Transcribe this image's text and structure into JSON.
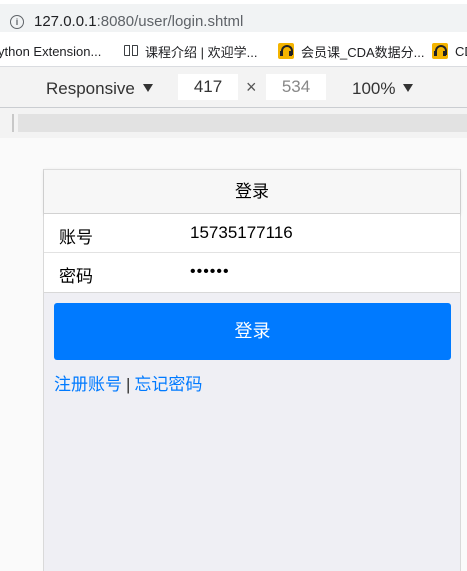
{
  "browser": {
    "url_host": "127.0.0.1",
    "url_rest": ":8080/user/login.shtml",
    "bookmarks": [
      {
        "label": "ython Extension..."
      },
      {
        "label": "课程介绍 | 欢迎学..."
      },
      {
        "label": "会员课_CDA数据分..."
      },
      {
        "label": "CD"
      }
    ]
  },
  "devtools": {
    "device": "Responsive",
    "width": "417",
    "times": "×",
    "height": "534",
    "zoom": "100%"
  },
  "page": {
    "title": "登录",
    "account_label": "账号",
    "account_value": "15735177116",
    "password_label": "密码",
    "password_value": "••••••",
    "login_button": "登录",
    "register_link": "注册账号",
    "separator": "|",
    "forgot_link": "忘记密码"
  },
  "colors": {
    "primary": "#007aff",
    "page_bg": "#efeff4"
  }
}
